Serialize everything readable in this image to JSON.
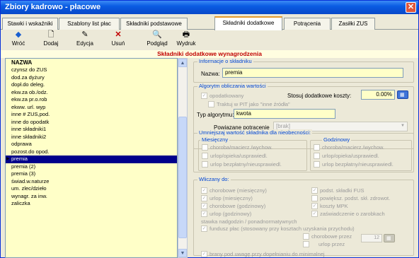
{
  "window": {
    "title": "Zbiory kadrowo - płacowe"
  },
  "tabs": [
    {
      "label": "Stawki i wskaźniki"
    },
    {
      "label": "Szablony list płac"
    },
    {
      "label": "Składniki podstawowe"
    },
    {
      "label": "Składniki dodatkowe"
    },
    {
      "label": "Potrącenia"
    },
    {
      "label": "Zasiłki ZUS"
    }
  ],
  "toolbar": {
    "back": "Wróć",
    "add": "Dodaj",
    "edit": "Edycja",
    "delete": "Usuń",
    "preview": "Podgląd",
    "print": "Wydruk"
  },
  "banner": "Składniki dodatkowe wynagrodzenia",
  "list": {
    "header": "NAZWA",
    "items": [
      "czynsz do ZUS",
      "dod.za dyżury",
      "dopł.do deleg.",
      "ekw.za ob./odz.",
      "ekw.za pr.o.rob",
      "ekww. url. wyp",
      "inne # ZUS,pod.",
      "inne do opodatk",
      "inne składniki1",
      "inne składniki2",
      "odprawa",
      "pozost.do opod.",
      "premia",
      "premia (2)",
      "premia (3)",
      "świad.w.naturze",
      "um. zlec/dzieło",
      "wynagr. za inw.",
      "zaliczka"
    ],
    "selected": "premia"
  },
  "info": {
    "group_title": "Informacje o składniku",
    "name_label": "Nazwa:",
    "name_value": "premia"
  },
  "algo": {
    "group_title": "Algorytm obliczania wartości",
    "taxed": "opodatkowany",
    "extra_costs_label": "Stosuj dodatkowe koszty:",
    "extra_costs_value": "0.00%",
    "pit_other": "Traktuj w PIT jako \"inne źródła\"",
    "type_label": "Typ algorytmu:",
    "type_value": "kwota",
    "linked_label": "Powiązane potrącenie",
    "linked_value": "[brak]"
  },
  "reduce": {
    "group_title": "Umniejszaj wartość składnika dla nieobecności:",
    "monthly_title": "Miesięczny",
    "hourly_title": "Godzinowy",
    "monthly": [
      "choroba/macierz./wychow.",
      "urlop/opieka/usprawiedl.",
      "urlop bezpłatny/nieusprawiedl."
    ],
    "hourly": [
      "choroba/macierz./wychow.",
      "urlop/opieka/usprawiedl.",
      "urlop bezpłatny/nieusprawiedl."
    ]
  },
  "included": {
    "group_title": "Wliczany do:",
    "left": [
      "chorobowe (miesięczny)",
      "urlop (miesięczny)",
      "chorobowe (godzinowy)",
      "urlop (godzinowy)"
    ],
    "right": [
      "podst. składki FUS",
      "powiększ. podst. skł. zdrowot.",
      "koszty MPK",
      "zaświadczenie o zarobkach"
    ],
    "overtime": "stawka nadgodzin / ponadnormatywnych",
    "fund": "fundusz płac (stosowany przy kosztach uzyskania przychodu)",
    "sick_every": "chorobowe przez",
    "vacation_every": "urlop przez",
    "months_value": "12",
    "minimum": "brany pod uwagę przy dopełnianiu do minimalnej"
  }
}
